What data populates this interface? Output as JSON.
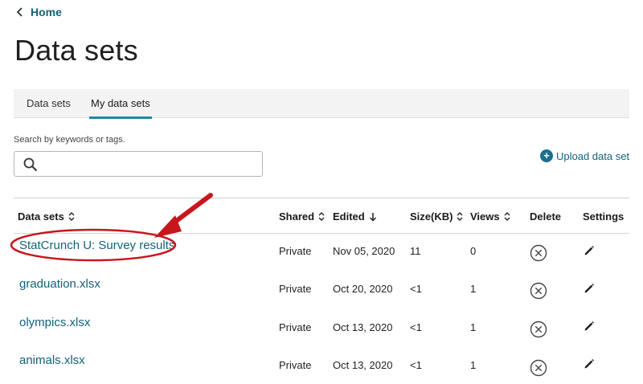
{
  "nav": {
    "back_label": "Home"
  },
  "page": {
    "title": "Data sets"
  },
  "tabs": [
    {
      "label": "Data sets",
      "active": false
    },
    {
      "label": "My data sets",
      "active": true
    }
  ],
  "search": {
    "label": "Search by keywords or tags.",
    "value": "",
    "placeholder": ""
  },
  "upload": {
    "label": "Upload data set"
  },
  "table": {
    "columns": {
      "name": "Data sets",
      "shared": "Shared",
      "edited": "Edited",
      "size": "Size(KB)",
      "views": "Views",
      "delete": "Delete",
      "settings": "Settings"
    },
    "rows": [
      {
        "name": "StatCrunch U: Survey results",
        "shared": "Private",
        "edited": "Nov 05, 2020",
        "size": "11",
        "views": "0"
      },
      {
        "name": "graduation.xlsx",
        "shared": "Private",
        "edited": "Oct 20, 2020",
        "size": "<1",
        "views": "1"
      },
      {
        "name": "olympics.xlsx",
        "shared": "Private",
        "edited": "Oct 13, 2020",
        "size": "<1",
        "views": "1"
      },
      {
        "name": "animals.xlsx",
        "shared": "Private",
        "edited": "Oct 13, 2020",
        "size": "<1",
        "views": "1"
      }
    ]
  },
  "icons": {
    "back": "chevron-left-icon",
    "search": "magnifier-icon",
    "upload": "plus-circle-icon",
    "sort": "sort-updown-icon",
    "sort_desc": "arrow-down-icon",
    "delete": "circle-x-icon",
    "settings": "pencil-icon"
  },
  "colors": {
    "link": "#12627a",
    "tab_underline": "#1a8aa8",
    "annotation": "#c8161d",
    "tab_bar_bg": "#f3f3f3"
  }
}
